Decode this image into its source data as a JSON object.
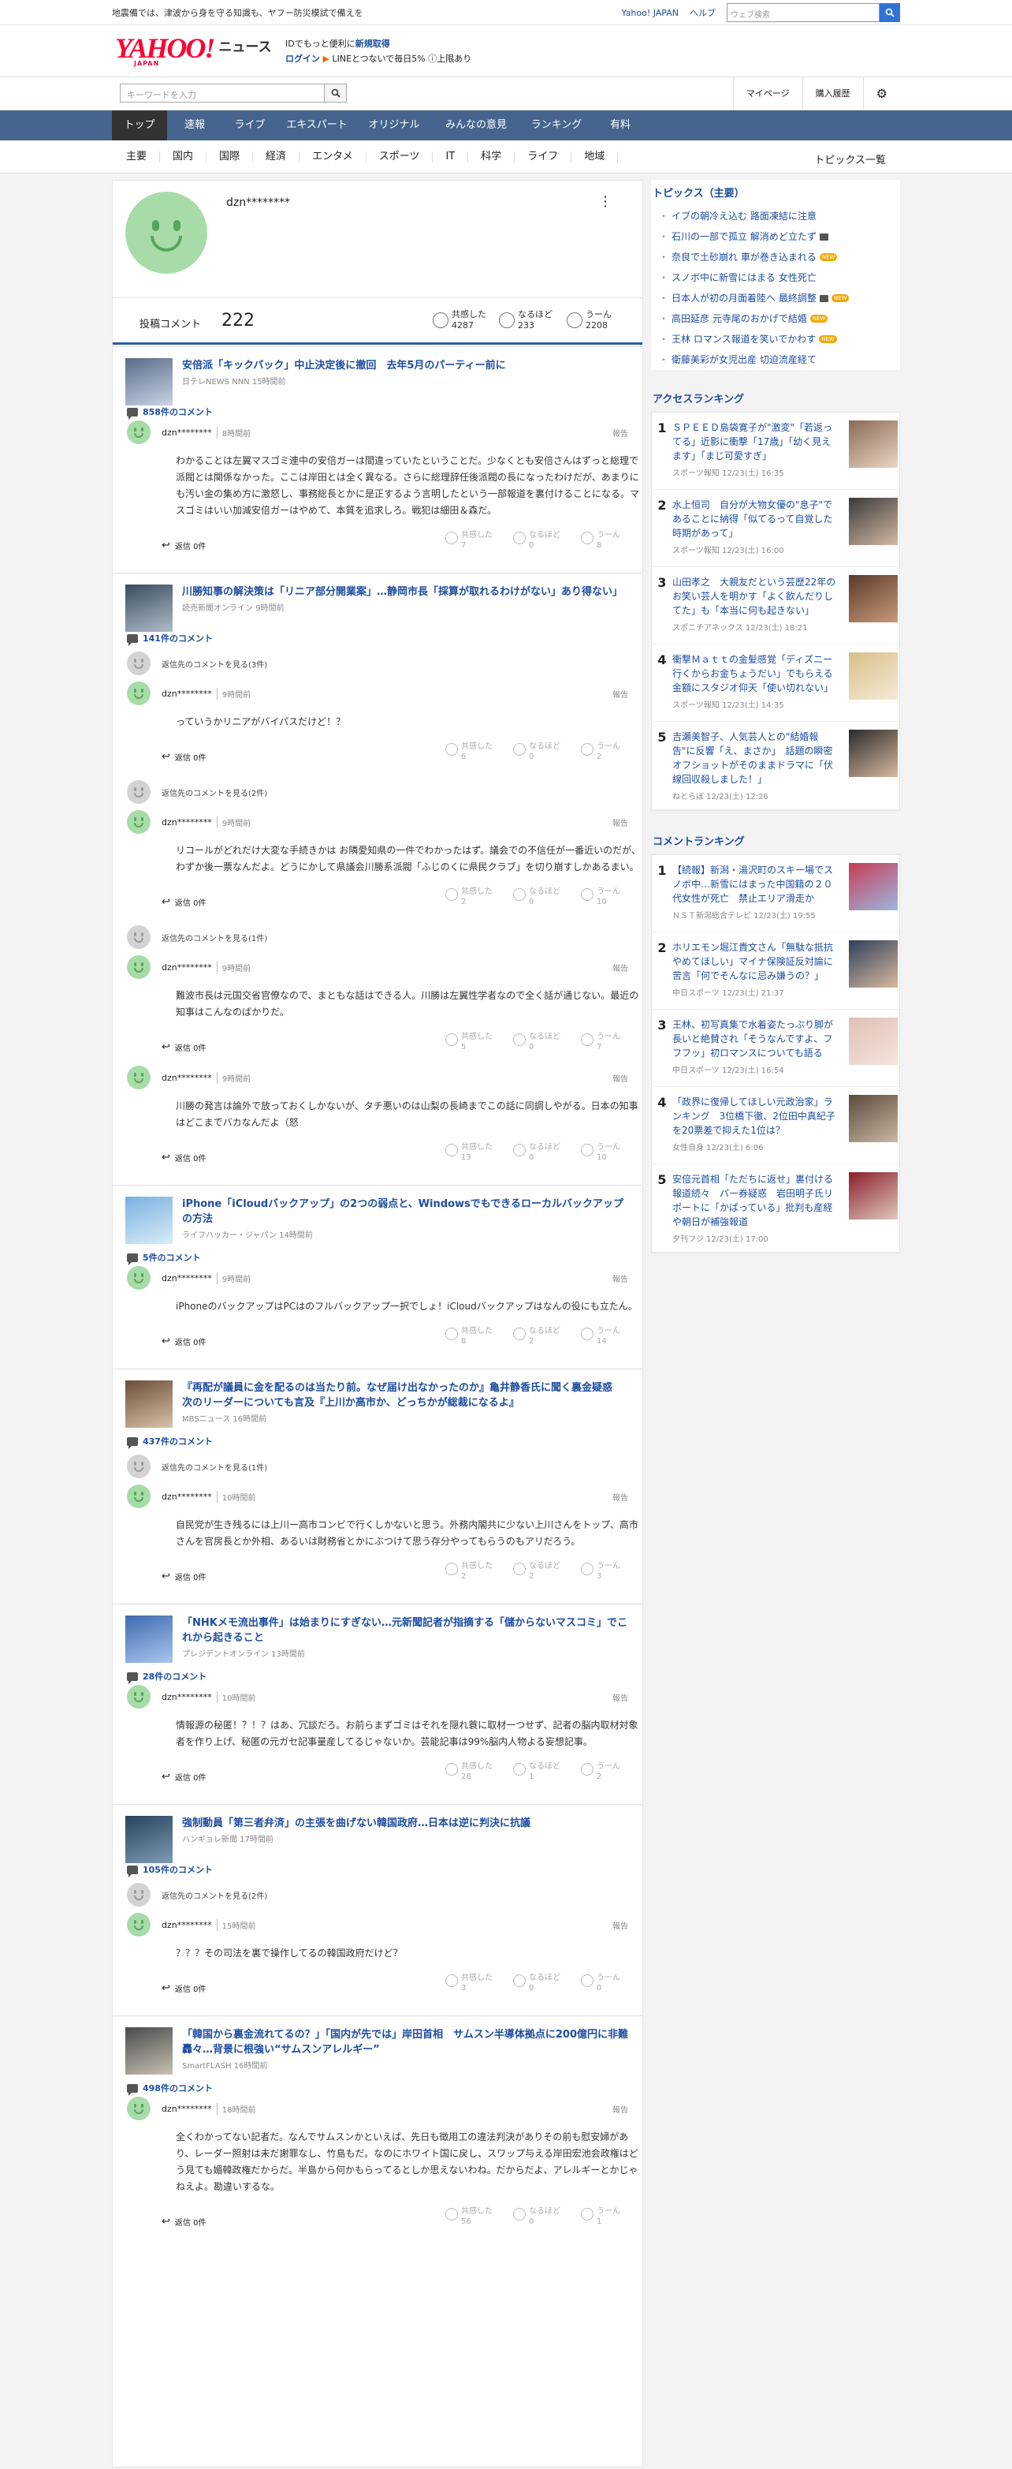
{
  "notice": {
    "text": "地震備では、津波から身を守る知識も、ヤフー防災模試で備えを",
    "links": [
      "Yahoo! JAPAN",
      "ヘルプ"
    ],
    "search_placeholder": "ウェブ検索"
  },
  "header": {
    "logo": "YAHOO!",
    "logo_sub": "JAPAN",
    "service": "ニュース",
    "promo": {
      "line1_prefix": "IDでもっと便利に",
      "line1_link": "新規取得",
      "line2_link": "ログイン",
      "line2_text": "LINEとつないで毎日5%",
      "line2_tail": "上限あり"
    }
  },
  "subbar": {
    "placeholder": "キーワードを入力",
    "links": [
      "マイページ",
      "購入履歴"
    ]
  },
  "gnav": [
    "トップ",
    "速報",
    "ライブ",
    "エキスパート",
    "オリジナル",
    "みんなの意見",
    "ランキング",
    "有料"
  ],
  "snav": [
    "主要",
    "国内",
    "国際",
    "経済",
    "エンタメ",
    "スポーツ",
    "IT",
    "科学",
    "ライフ",
    "地域"
  ],
  "snav_right": "トピックス一覧",
  "profile": {
    "name": "dzn********",
    "comments_label": "投稿コメント",
    "comments": "222",
    "reactions": [
      {
        "label": "共感した",
        "value": "4287"
      },
      {
        "label": "なるほど",
        "value": "233"
      },
      {
        "label": "うーん",
        "value": "2208"
      }
    ]
  },
  "labels": {
    "report": "報告",
    "reply": "返信 0件",
    "agree": "共感した",
    "nod": "なるほど",
    "hmm": "うーん"
  },
  "articles": [
    {
      "title": "安倍派「キックバック」中止決定後に撤回　去年5月のパーティー前に",
      "source": "日テレNEWS NNN 15時間前",
      "count": "858件のコメント",
      "comments": [
        {
          "name": "dzn********",
          "time": "8時間前",
          "text": "わかることは左翼マスゴミ連中の安倍ガーは間違っていたということだ。少なくとも安倍さんはずっと総理で派閥とは関係なかった。ここは岸田とは全く異なる。さらに総理辞任後派閥の長になったわけだが、あまりにも汚い金の集め方に激怒し、事務総長とかに是正するよう言明したという一部報道を裏付けることになる。マスゴミはいい加減安倍ガーはやめて、本質を追求しろ。戦犯は細田＆森だ。",
          "v": [
            "7",
            "0",
            "8"
          ]
        }
      ]
    },
    {
      "title": "川勝知事の解決策は「リニア部分開業案」…静岡市長「採算が取れるわけがない」あり得ない」",
      "source": "読売新聞オンライン 9時間前",
      "count": "141件のコメント",
      "comments": [
        {
          "reply_label": "返信先のコメントを見る(3件)",
          "name": "dzn********",
          "time": "9時間前",
          "text": "っていうかリニアがバイパスだけど！？",
          "v": [
            "6",
            "0",
            "2"
          ]
        },
        {
          "reply_label": "返信先のコメントを見る(2件)",
          "name": "dzn********",
          "time": "9時間前",
          "text": "リコールがどれだけ大変な手続きかは お隣愛知県の一件でわかったはず。議会での不信任が一番近いのだが、わずか後一票なんだよ。どうにかして県議会川勝系派閥「ふじのくに県民クラブ」を切り崩すしかあるまい。",
          "v": [
            "2",
            "0",
            "10"
          ]
        },
        {
          "reply_label": "返信先のコメントを見る(1件)",
          "name": "dzn********",
          "time": "9時間前",
          "text": "難波市長は元国交省官僚なので、まともな話はできる人。川勝は左翼性学者なので全く話が通じない。最近の知事はこんなのばかりだ。",
          "v": [
            "5",
            "0",
            "7"
          ]
        },
        {
          "name": "dzn********",
          "time": "9時間前",
          "text": "川勝の発言は論外で放っておくしかないが、タチ悪いのは山梨の長崎までこの話に同調しやがる。日本の知事はどこまでバカなんだよ（怒",
          "v": [
            "13",
            "0",
            "10"
          ]
        }
      ]
    },
    {
      "title": "iPhone「iCloudバックアップ」の2つの弱点と、Windowsでもできるローカルバックアップの方法",
      "source": "ライフハッカー・ジャパン 14時間前",
      "count": "5件のコメント",
      "comments": [
        {
          "name": "dzn********",
          "time": "9時間前",
          "text": "iPhoneのバックアップはPCはのフルバックアップ一択でしょ！iCloudバックアップはなんの役にも立たん。",
          "v": [
            "8",
            "2",
            "14"
          ]
        }
      ]
    },
    {
      "title": "『再配が議員に金を配るのは当たり前。なぜ届け出なかったのか』亀井静香氏に聞く裏金疑惑　次のリーダーについても言及『上川か高市か、どっちかが総裁になるよ』",
      "source": "MBSニュース 16時間前",
      "count": "437件のコメント",
      "comments": [
        {
          "reply_label": "返信先のコメントを見る(1件)",
          "name": "dzn********",
          "time": "10時間前",
          "text": "自民党が生き残るには上川ー高市コンビで行くしかないと思う。外務内閣共に少ない上川さんをトップ、高市さんを官房長とか外相、あるいは財務省とかにぶつけて思う存分やってもらうのもアリだろう。",
          "v": [
            "2",
            "2",
            "3"
          ]
        }
      ]
    },
    {
      "title": "「NHKメモ流出事件」は始まりにすぎない…元新聞記者が指摘する「儲からないマスコミ」でこれから起きること",
      "source": "プレジデントオンライン 13時間前",
      "count": "28件のコメント",
      "comments": [
        {
          "name": "dzn********",
          "time": "10時間前",
          "text": "情報源の秘匿！？！？はあ、冗談だろ。お前らまずゴミはそれを隠れ蓑に取材一つせず、記者の脳内取材対象者を作り上げ、秘匿の元ガセ記事量産してるじゃないか。芸能記事は99%脳内人物よる妄想記事。",
          "v": [
            "28",
            "1",
            "2"
          ]
        }
      ]
    },
    {
      "title": "強制動員「第三者弁済」の主張を曲げない韓国政府…日本は逆に判決に抗議",
      "source": "ハンギョレ新聞 17時間前",
      "count": "105件のコメント",
      "comments": [
        {
          "reply_label": "返信先のコメントを見る(2件)",
          "name": "dzn********",
          "time": "15時間前",
          "text": "？？？その司法を裏で操作してるの韓国政府だけど？",
          "v": [
            "3",
            "0",
            "0"
          ]
        }
      ]
    },
    {
      "title": "「韓国から裏金流れてるの？」「国内が先では」岸田首相　サムスン半導体拠点に200億円に非難轟々…背景に根強い“サムスンアレルギー”",
      "source": "SmartFLASH 16時間前",
      "count": "498件のコメント",
      "comments": [
        {
          "name": "dzn********",
          "time": "18時間前",
          "text": "全くわかってない記者だ。なんでサムスンかといえば、先日も徴用工の違法判決がありその前も慰安婦があり、レーダー照射は未だ謝罪なし、竹島もだ。なのにホワイト国に戻し、スワップ与える岸田宏池会政権はどう見ても媚韓政権だからだ。半島から何かもらってるとしか思えないわね。だからだよ、アレルギーとかじゃねえよ。勘違いするな。",
          "v": [
            "56",
            "0",
            "1"
          ]
        }
      ]
    }
  ],
  "sidebar": {
    "topics_title": "トピックス（主要）",
    "topics": [
      {
        "text": "イブの朝冷え込む 路面凍結に注意",
        "tag": ""
      },
      {
        "text": "石川の一部で孤立 解消めど立たず",
        "tag": "cam"
      },
      {
        "text": "奈良で土砂崩れ 車が巻き込まれる",
        "tag": "NEW"
      },
      {
        "text": "スノボ中に新雪にはまる 女性死亡",
        "tag": ""
      },
      {
        "text": "日本人が初の月面着陸へ 最終調整",
        "tag": "cam+new"
      },
      {
        "text": "高田延彦 元寺尾のおかげで結婚",
        "tag": "NEW"
      },
      {
        "text": "王林 ロマンス報道を笑いでかわす",
        "tag": "NEW"
      },
      {
        "text": "衛藤美彩が女児出産 切迫流産経て",
        "tag": ""
      }
    ],
    "new_label": "NEW",
    "access_title": "アクセスランキング",
    "access": [
      {
        "title": "ＳＰＥＥＤ島袋寛子が\"激変\"「若返ってる」近影に衝撃「17歳」「幼く見えます」「まじ可愛すぎ」",
        "src": "スポーツ報知 12/23(土) 16:35"
      },
      {
        "title": "水上恒司　自分が大物女優の\"息子\"であることに納得「似てるって自覚した時期があって」",
        "src": "スポーツ報知 12/23(土) 16:00"
      },
      {
        "title": "山田孝之　大親友だという芸歴22年のお笑い芸人を明かす「よく飲んだりしてた」も「本当に何も起きない」",
        "src": "スポニチアネックス 12/23(土) 18:21"
      },
      {
        "title": "衝撃Ｍａｔｔの金髪感覚「ディズニー行くからお金ちょうだい」でもらえる金額にスタジオ仰天「使い切れない」",
        "src": "スポーツ報知 12/23(土) 14:35"
      },
      {
        "title": "吉瀬美智子、人気芸人との\"結婚報告\"に反響「え、まさか」　話題の瞬密オフショットがそのままドラマに「伏線回収殺しました！」",
        "src": "ねとらぼ 12/23(土) 12:26"
      }
    ],
    "comment_title": "コメントランキング",
    "crank": [
      {
        "title": "【続報】新潟・湯沢町のスキー場でスノボ中…新雪にはまった中国籍の２０代女性が死亡　禁止エリア滑走か",
        "src": "ＮＳＴ新潟総合テレビ 12/23(土) 19:55"
      },
      {
        "title": "ホリエモン堀江貴文さん「無駄な抵抗やめてほしい」マイナ保険証反対論に苦言「何でそんなに忌み嫌うの？」",
        "src": "中日スポーツ 12/23(土) 21:37"
      },
      {
        "title": "王林、初写真集で水着姿たっぷり脚が長いと絶賛され「そうなんですよ、フフフッ」初ロマンスについても語る",
        "src": "中日スポーツ 12/23(土) 16:54"
      },
      {
        "title": "「政界に復帰してほしい元政治家」ランキング　3位橋下徹、2位田中真紀子を20票差で抑えた1位は？",
        "src": "女性自身 12/23(土) 6:06"
      },
      {
        "title": "安倍元首相「ただちに返せ」裏付ける報道続々　パー券疑惑　岩田明子氏リポートに「かばっている」批判も産経や朝日が補強報道",
        "src": "夕刊フジ 12/23(土) 17:00"
      }
    ]
  },
  "colors": {
    "accent": "#1e4da0",
    "nav": "#45658f",
    "logo": "#ff0033",
    "avatar": "#a7dca9"
  }
}
